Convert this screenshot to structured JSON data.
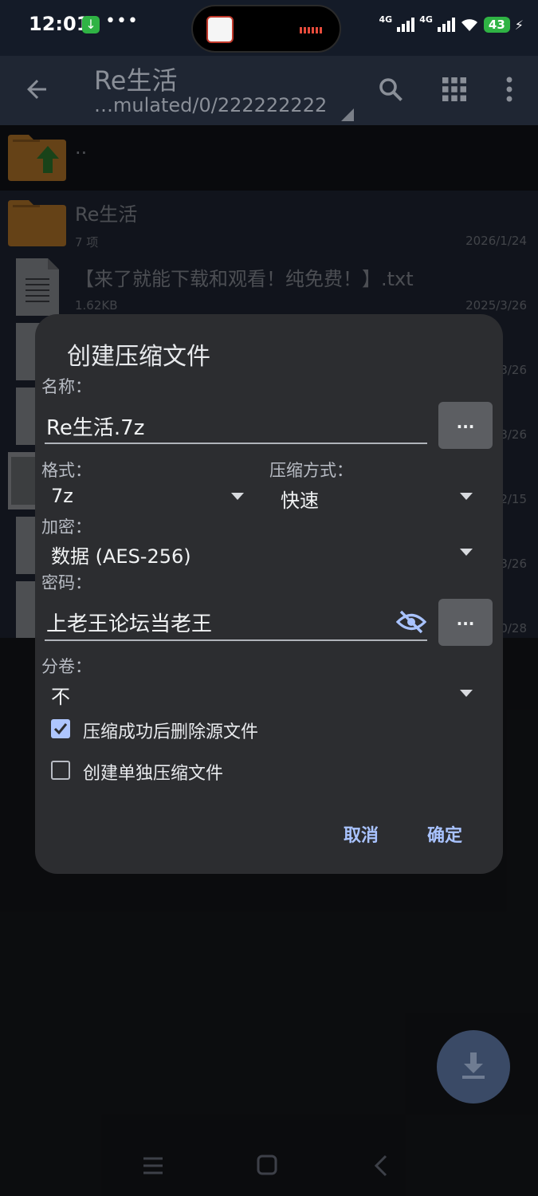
{
  "status": {
    "time": "12:01",
    "network1": "4G",
    "network2": "4G",
    "battery": "43"
  },
  "appbar": {
    "title": "Re生活",
    "path": "…mulated/0/222222222"
  },
  "list": {
    "parent_label": "..",
    "items": [
      {
        "name": "Re生活",
        "meta": "7 项",
        "date": "2026/1/24",
        "type": "folder"
      },
      {
        "name": "【来了就能下载和观看！纯免费！】.txt",
        "meta": "1.62KB",
        "date": "2025/3/26",
        "type": "file"
      },
      {
        "date": "3/26"
      },
      {
        "date": "3/26"
      },
      {
        "date": "2/15"
      },
      {
        "date": "3/26"
      },
      {
        "date": "0/28"
      }
    ]
  },
  "dialog": {
    "title": "创建压缩文件",
    "name_label": "名称：",
    "name_value": "Re生活.7z",
    "more_label": "...",
    "format_label": "格式：",
    "format_value": "7z",
    "method_label": "压缩方式：",
    "method_value": "快速",
    "encrypt_label": "加密：",
    "encrypt_value": "数据 (AES-256)",
    "password_label": "密码：",
    "password_value": "上老王论坛当老王",
    "split_label": "分卷：",
    "split_value": "不",
    "delete_source_label": "压缩成功后删除源文件",
    "delete_source_checked": true,
    "separate_label": "创建单独压缩文件",
    "separate_checked": false,
    "cancel_label": "取消",
    "ok_label": "确定"
  },
  "colors": {
    "accent": "#a9c3ff",
    "dialog_bg": "#2c2d30",
    "folder": "#d4872a"
  }
}
